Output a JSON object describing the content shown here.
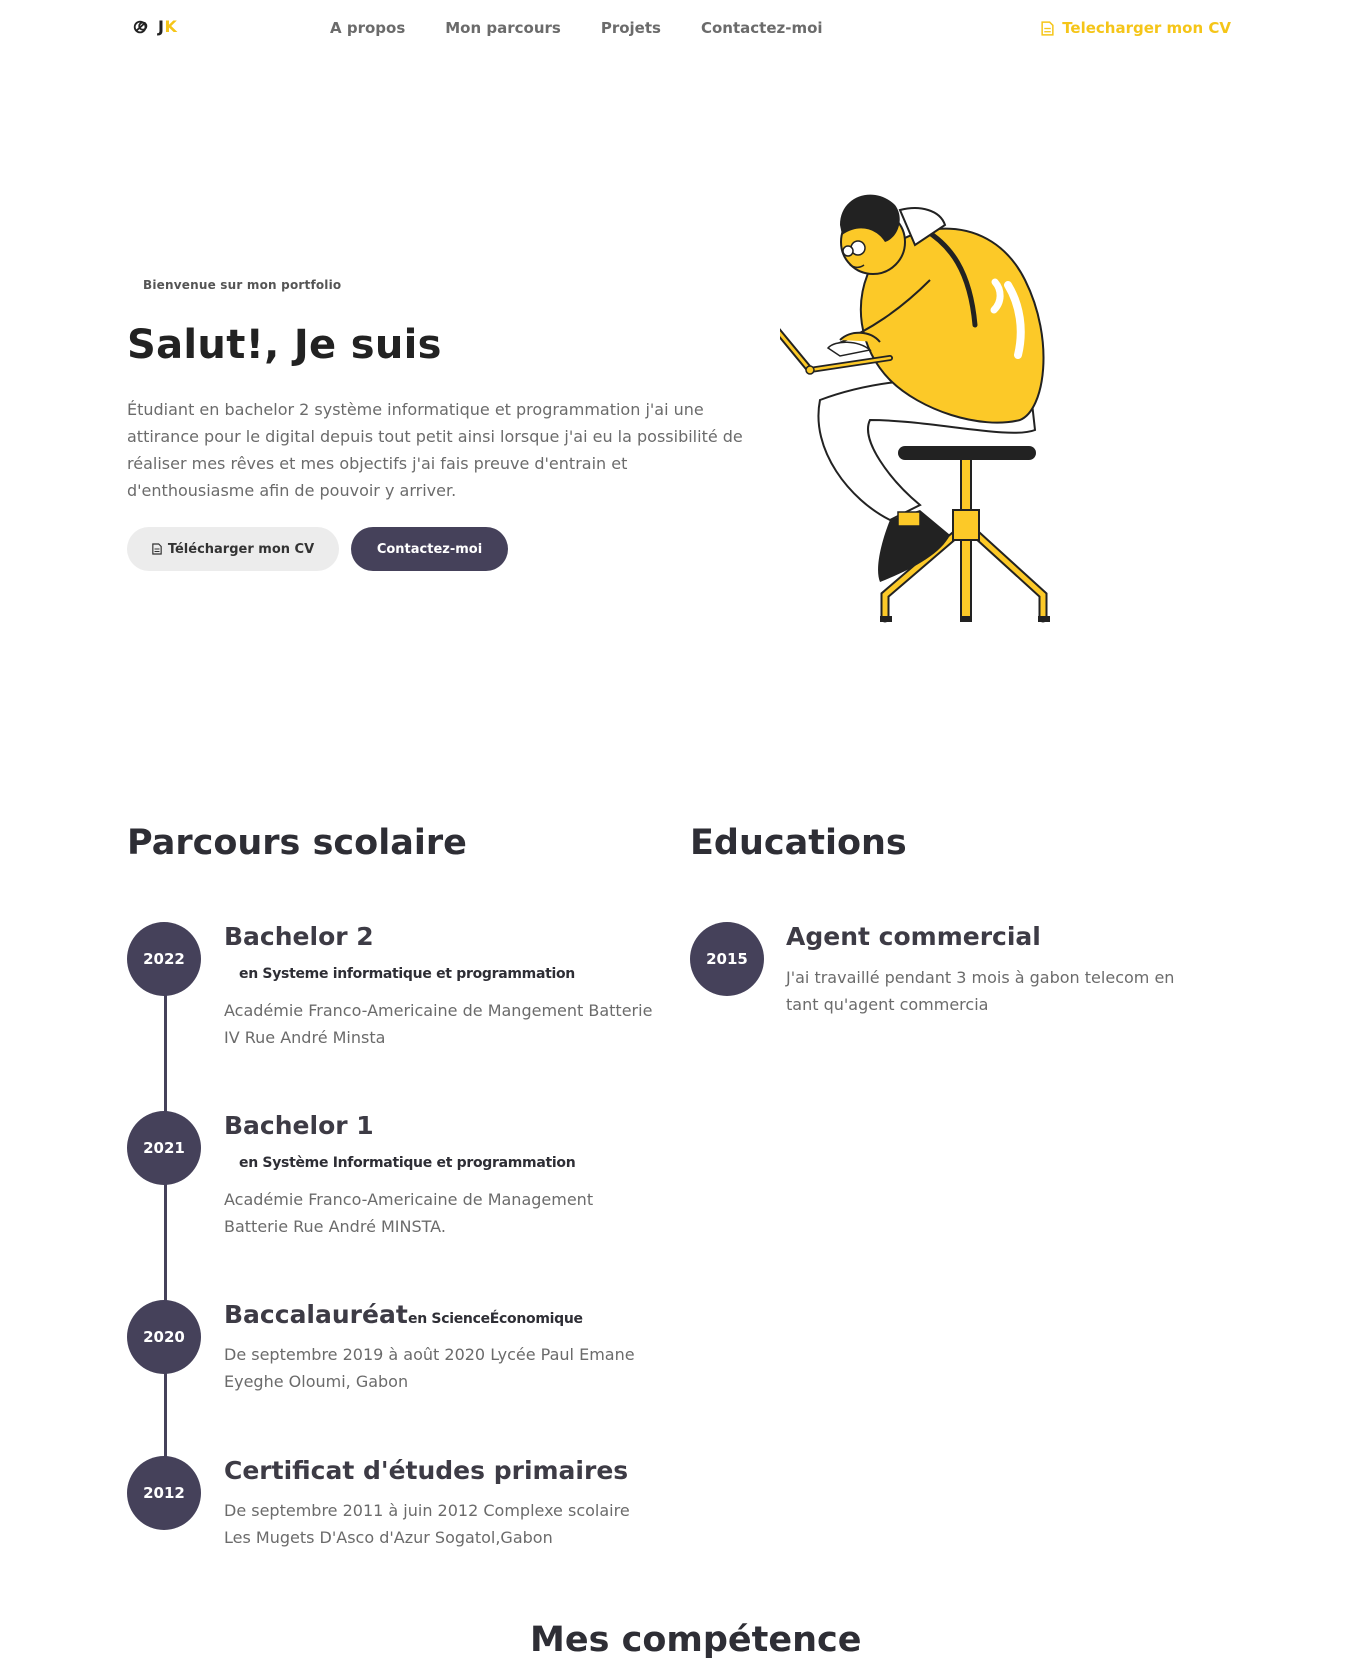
{
  "nav": {
    "brand_j": "J",
    "brand_k": "K",
    "links": [
      "A propos",
      "Mon parcours",
      "Projets",
      "Contactez-moi"
    ],
    "cv_label": "Telecharger mon CV"
  },
  "hero": {
    "kicker": "Bienvenue sur mon portfolio",
    "title": "Salut!, Je suis",
    "text": "Étudiant en bachelor 2 système informatique et programmation j'ai une attirance pour le digital depuis tout petit ainsi lorsque j'ai eu la possibilité de réaliser mes rêves et mes objectifs j'ai fais preuve d'entrain et d'enthousiasme afin de pouvoir y arriver.",
    "cv_button": "Télécharger mon CV",
    "contact_button": "Contactez-moi"
  },
  "parcours": {
    "title": "Parcours scolaire",
    "entries": [
      {
        "year": "2022",
        "title": "Bachelor 2",
        "subtitle": "en Systeme informatique et programmation",
        "desc": "Académie Franco-Americaine de Mangement Batterie IV Rue André Minsta"
      },
      {
        "year": "2021",
        "title": "Bachelor 1",
        "subtitle": "en Système Informatique et programmation",
        "desc": "Académie Franco-Americaine de Management Batterie Rue André MINSTA."
      },
      {
        "year": "2020",
        "title": "Baccalauréat",
        "subtitle": "en ScienceÉconomique",
        "desc": "De septembre 2019 à août 2020 Lycée Paul Emane Eyeghe Oloumi, Gabon"
      },
      {
        "year": "2012",
        "title": "Certificat d'études primaires",
        "subtitle": "",
        "desc": "De septembre 2011 à juin 2012 Complexe scolaire Les Mugets D'Asco d'Azur Sogatol,Gabon"
      }
    ]
  },
  "educations": {
    "title": "Educations",
    "entries": [
      {
        "year": "2015",
        "title": "Agent commercial",
        "desc": "J'ai travaillé pendant 3 mois à gabon telecom en tant qu'agent commercia"
      }
    ]
  },
  "next_section": {
    "title": "Mes compétence"
  },
  "colors": {
    "accent": "#f5c518",
    "dark": "#45415a",
    "text_muted": "#6b6b6b"
  }
}
